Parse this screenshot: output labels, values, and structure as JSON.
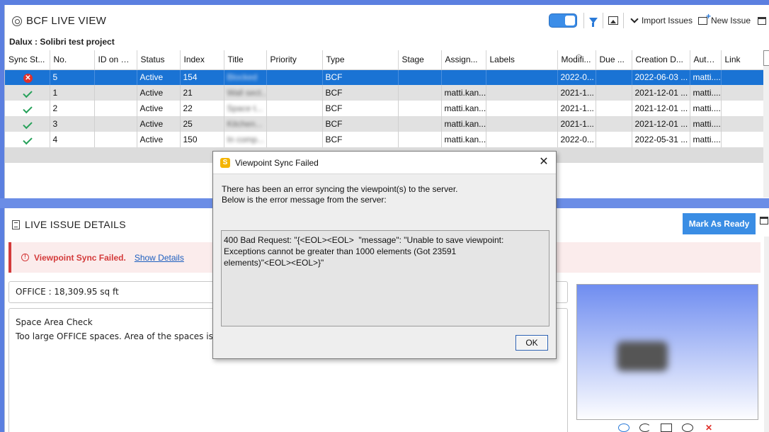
{
  "header": {
    "title": "BCF LIVE VIEW",
    "project": "Dalux : Solibri test project"
  },
  "toolbar": {
    "import_label": "Import Issues",
    "new_label": "New Issue",
    "toggle_on": true
  },
  "table": {
    "columns": [
      "Sync St...",
      "No.",
      "ID on S...",
      "Status",
      "Index",
      "Title",
      "Priority",
      "Type",
      "Stage",
      "Assign...",
      "Labels",
      "Modifi...",
      "Due ...",
      "Creation D...",
      "Author",
      "Link"
    ],
    "rows": [
      {
        "sync": "error",
        "no": "5",
        "status": "Active",
        "index": "154",
        "title": "Blocked",
        "type": "BCF",
        "assign": "",
        "modified": "2022-0...",
        "created": "2022-06-03 ...",
        "author": "matti...."
      },
      {
        "sync": "ok",
        "no": "1",
        "status": "Active",
        "index": "21",
        "title": "Wall sect...",
        "type": "BCF",
        "assign": "matti.kan...",
        "modified": "2021-1...",
        "created": "2021-12-01 ...",
        "author": "matti...."
      },
      {
        "sync": "ok",
        "no": "2",
        "status": "Active",
        "index": "22",
        "title": "Space t...",
        "type": "BCF",
        "assign": "matti.kan...",
        "modified": "2021-1...",
        "created": "2021-12-01 ...",
        "author": "matti...."
      },
      {
        "sync": "ok",
        "no": "3",
        "status": "Active",
        "index": "25",
        "title": "Kitchen...",
        "type": "BCF",
        "assign": "matti.kan...",
        "modified": "2021-1...",
        "created": "2021-12-01 ...",
        "author": "matti...."
      },
      {
        "sync": "ok",
        "no": "4",
        "status": "Active",
        "index": "150",
        "title": "In comp...",
        "type": "BCF",
        "assign": "matti.kan...",
        "modified": "2022-0...",
        "created": "2022-05-31 ...",
        "author": "matti...."
      }
    ]
  },
  "details": {
    "title": "LIVE ISSUE DETAILS",
    "ready_label": "Mark As Ready",
    "alert_message": "Viewpoint Sync Failed.",
    "alert_link": "Show Details",
    "field_value": "OFFICE : 18,309.95 sq ft",
    "desc_line1": "Space Area Check",
    "desc_line2": "Too large OFFICE spaces. Area of the spaces is"
  },
  "dialog": {
    "title": "Viewpoint Sync Failed",
    "line1": "There has been an error syncing the viewpoint(s) to the server.",
    "line2": "Below is the error message from the server:",
    "error": "400 Bad Request: \"{<EOL><EOL>  \"message\": \"Unable to save viewpoint:\nExceptions cannot be greater than 1000 elements (Got 23591\nelements)\"<EOL><EOL>}\"",
    "ok_label": "OK"
  }
}
